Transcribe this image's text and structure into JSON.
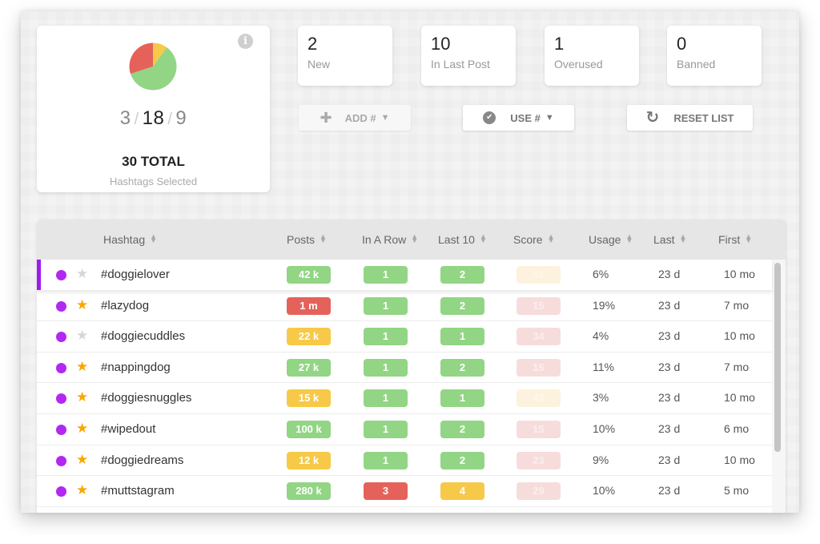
{
  "summary": {
    "info_icon": "info-icon",
    "counts": {
      "low": "3",
      "mid": "18",
      "high": "9",
      "separator": "/"
    },
    "total_label": "30 TOTAL",
    "subtitle": "Hashtags Selected",
    "colors": {
      "low": "#f7c948",
      "mid": "#92d584",
      "high": "#e5625a"
    }
  },
  "chart_data": {
    "type": "pie",
    "title": "",
    "slices": [
      {
        "label": "yellow",
        "value": 3,
        "color": "#f7c948"
      },
      {
        "label": "green",
        "value": 18,
        "color": "#92d584"
      },
      {
        "label": "red",
        "value": 9,
        "color": "#e5625a"
      }
    ]
  },
  "stats": [
    {
      "value": "2",
      "label": "New"
    },
    {
      "value": "10",
      "label": "In Last Post"
    },
    {
      "value": "1",
      "label": "Overused"
    },
    {
      "value": "0",
      "label": "Banned"
    }
  ],
  "actions": {
    "add": {
      "icon": "plus-icon",
      "label": "ADD #",
      "caret": "▼",
      "disabled": true
    },
    "use": {
      "icon": "check-circle-icon",
      "label": "USE #",
      "caret": "▼"
    },
    "reset": {
      "icon": "refresh-icon",
      "label": "RESET LIST"
    }
  },
  "table": {
    "columns": [
      "Hashtag",
      "Posts",
      "In A Row",
      "Last 10",
      "Score",
      "Usage",
      "Last",
      "First"
    ],
    "rows": [
      {
        "starred": false,
        "selected": true,
        "tag": "#doggielover",
        "posts": "42 k",
        "posts_c": "green",
        "row": "1",
        "row_c": "green",
        "last10": "2",
        "last10_c": "green",
        "score": "41",
        "score_c": "pale-yellow",
        "usage": "6%",
        "last": "23 d",
        "first": "10 mo"
      },
      {
        "starred": true,
        "selected": false,
        "tag": "#lazydog",
        "posts": "1 m",
        "posts_c": "red",
        "row": "1",
        "row_c": "green",
        "last10": "2",
        "last10_c": "green",
        "score": "15",
        "score_c": "pale-red",
        "usage": "19%",
        "last": "23 d",
        "first": "7 mo"
      },
      {
        "starred": false,
        "selected": false,
        "tag": "#doggiecuddles",
        "posts": "22 k",
        "posts_c": "yellow",
        "row": "1",
        "row_c": "green",
        "last10": "1",
        "last10_c": "green",
        "score": "34",
        "score_c": "pale-red",
        "usage": "4%",
        "last": "23 d",
        "first": "10 mo"
      },
      {
        "starred": true,
        "selected": false,
        "tag": "#nappingdog",
        "posts": "27 k",
        "posts_c": "green",
        "row": "1",
        "row_c": "green",
        "last10": "2",
        "last10_c": "green",
        "score": "15",
        "score_c": "pale-red",
        "usage": "11%",
        "last": "23 d",
        "first": "7 mo"
      },
      {
        "starred": true,
        "selected": false,
        "tag": "#doggiesnuggles",
        "posts": "15 k",
        "posts_c": "yellow",
        "row": "1",
        "row_c": "green",
        "last10": "1",
        "last10_c": "green",
        "score": "42",
        "score_c": "pale-yellow",
        "usage": "3%",
        "last": "23 d",
        "first": "10 mo"
      },
      {
        "starred": true,
        "selected": false,
        "tag": "#wipedout",
        "posts": "100 k",
        "posts_c": "green",
        "row": "1",
        "row_c": "green",
        "last10": "2",
        "last10_c": "green",
        "score": "15",
        "score_c": "pale-red",
        "usage": "10%",
        "last": "23 d",
        "first": "6 mo"
      },
      {
        "starred": true,
        "selected": false,
        "tag": "#doggiedreams",
        "posts": "12 k",
        "posts_c": "yellow",
        "row": "1",
        "row_c": "green",
        "last10": "2",
        "last10_c": "green",
        "score": "23",
        "score_c": "pale-red",
        "usage": "9%",
        "last": "23 d",
        "first": "10 mo"
      },
      {
        "starred": true,
        "selected": false,
        "tag": "#muttstagram",
        "posts": "280 k",
        "posts_c": "green",
        "row": "3",
        "row_c": "red",
        "last10": "4",
        "last10_c": "yellow",
        "score": "29",
        "score_c": "pale-red",
        "usage": "10%",
        "last": "23 d",
        "first": "5 mo"
      }
    ]
  }
}
